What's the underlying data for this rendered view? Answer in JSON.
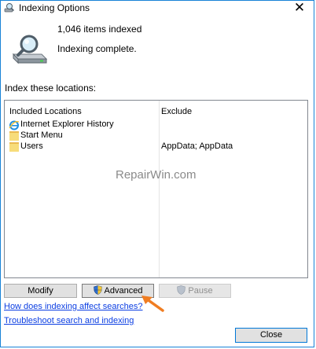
{
  "window": {
    "title": "Indexing Options",
    "close_glyph": "✕"
  },
  "status": {
    "items_indexed": "1,046 items indexed",
    "state": "Indexing complete."
  },
  "locations": {
    "section_label": "Index these locations:",
    "columns": {
      "included": "Included Locations",
      "exclude": "Exclude"
    },
    "rows": [
      {
        "location": "Internet Explorer History",
        "exclude": "",
        "icon": "ie-icon"
      },
      {
        "location": "Start Menu",
        "exclude": "",
        "icon": "folder-icon"
      },
      {
        "location": "Users",
        "exclude": "AppData; AppData",
        "icon": "folder-icon"
      }
    ]
  },
  "watermark": "RepairWin.com",
  "buttons": {
    "modify": "Modify",
    "advanced": "Advanced",
    "pause": "Pause",
    "close": "Close"
  },
  "links": {
    "how_indexing": "How does indexing affect searches?",
    "troubleshoot": "Troubleshoot search and indexing"
  },
  "colors": {
    "accent": "#0078d7",
    "link": "#0b3ee2",
    "arrow": "#f07d22"
  }
}
